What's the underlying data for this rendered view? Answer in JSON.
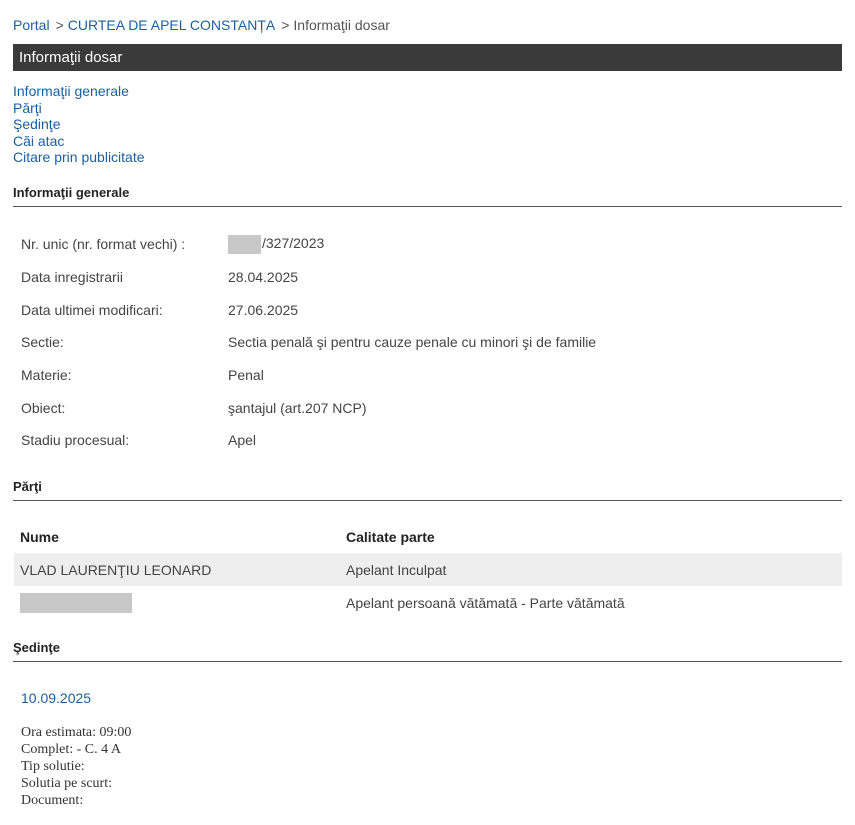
{
  "breadcrumb": {
    "portal": "Portal",
    "court": "CURTEA DE APEL CONSTANȚA",
    "current": "Informaţii dosar",
    "separator": ">"
  },
  "title_bar": "Informaţii dosar",
  "nav_links": [
    "Informaţii generale",
    "Părţi",
    "Şedinţe",
    "Căi atac",
    "Citare prin publicitate"
  ],
  "sections": {
    "general": "Informaţii generale",
    "parties": "Părţi",
    "hearings": "Şedinţe"
  },
  "general_info": [
    {
      "label": "Nr. unic (nr. format vechi) :",
      "value": "/327/2023",
      "redacted_prefix": true
    },
    {
      "label": "Data inregistrarii",
      "value": "28.04.2025"
    },
    {
      "label": "Data ultimei modificari:",
      "value": "27.06.2025"
    },
    {
      "label": "Sectie:",
      "value": "Sectia penală şi pentru cauze penale cu minori şi de familie"
    },
    {
      "label": "Materie:",
      "value": "Penal"
    },
    {
      "label": "Obiect:",
      "value": "şantajul (art.207 NCP)"
    },
    {
      "label": "Stadiu procesual:",
      "value": "Apel"
    }
  ],
  "parties_table": {
    "headers": [
      "Nume",
      "Calitate parte"
    ],
    "rows": [
      {
        "name": "VLAD LAURENŢIU LEONARD",
        "role": "Apelant Inculpat"
      },
      {
        "name": "",
        "name_redacted": true,
        "role": "Apelant persoană vătămată - Parte vătămată"
      }
    ]
  },
  "hearing": {
    "date": "10.09.2025",
    "details": [
      "Ora estimata: 09:00",
      "Complet: - C. 4 A",
      "Tip solutie:",
      "Solutia pe scurt:",
      "Document:"
    ]
  }
}
